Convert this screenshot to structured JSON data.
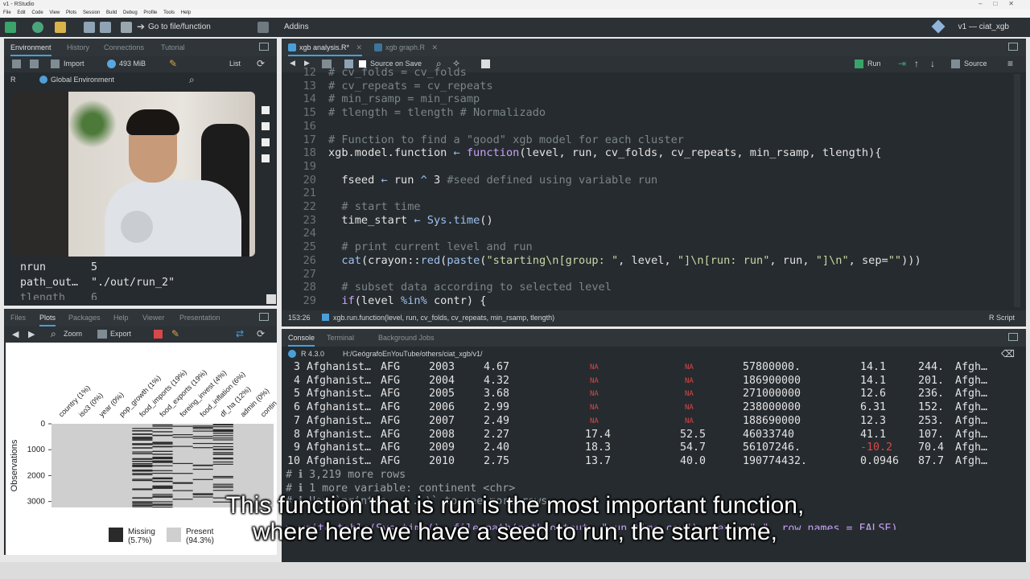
{
  "window": {
    "title": "v1 - RStudio"
  },
  "menu": [
    "File",
    "Edit",
    "Code",
    "View",
    "Plots",
    "Session",
    "Build",
    "Debug",
    "Profile",
    "Tools",
    "Help"
  ],
  "toolbar": {
    "goto": "Go to file/function",
    "addins": "Addins",
    "project": "v1 — ciat_xgb"
  },
  "env_pane": {
    "tabs": [
      "Environment",
      "History",
      "Connections",
      "Tutorial"
    ],
    "import_label": "Import",
    "memory": "493 MiB",
    "list_label": "List",
    "r_label": "R",
    "scope": "Global Environment",
    "vars": [
      {
        "name": "nrun",
        "value": "5"
      },
      {
        "name": "path_out…",
        "value": "\"./out/run_2\""
      },
      {
        "name": "tlength",
        "value": "6"
      }
    ]
  },
  "files_pane": {
    "tabs": [
      "Files",
      "Plots",
      "Packages",
      "Help",
      "Viewer",
      "Presentation"
    ],
    "zoom_label": "Zoom",
    "export_label": "Export"
  },
  "chart_data": {
    "type": "heatmap",
    "columns": [
      "country (1%)",
      "iso3 (0%)",
      "year (0%)",
      "pop_growth (1%)",
      "food_imports (19%)",
      "food_exports (19%)",
      "foreing_invest (4%)",
      "food_inflation (6%)",
      "df_ha (12%)",
      "admin (0%)",
      "contin"
    ],
    "ylabel": "Observations",
    "yticks": [
      "0",
      "1000",
      "2000",
      "3000"
    ],
    "ylim": [
      0,
      3229
    ],
    "legend": [
      {
        "label": "Missing",
        "pct": "(5.7%)",
        "color": "#2a2a2a"
      },
      {
        "label": "Present",
        "pct": "(94.3%)",
        "color": "#cfcfcf"
      }
    ]
  },
  "editor": {
    "tabs": [
      "xgb analysis.R*",
      "xgb graph.R"
    ],
    "source_on_save": "Source on Save",
    "run_label": "Run",
    "source_label": "Source",
    "status_pos": "153:26",
    "status_fn": "xgb.run.function(level, run, cv_folds, cv_repeats, min_rsamp, tlength)",
    "status_type": "R Script"
  },
  "console": {
    "tabs": [
      "Console",
      "Terminal",
      "Background Jobs"
    ],
    "r_version": "R 4.3.0",
    "path": "H:/GeógrafoEnYouTube/others/ciat_xgb/v1/",
    "rows": [
      {
        "i": "3",
        "c": "Afghanist…",
        "iso": "AFG",
        "y": "2003",
        "g": "4.67",
        "a": "NA",
        "b": "NA",
        "p": "57800000.",
        "d": "14.1",
        "e": "244.",
        "f": "Afgh…"
      },
      {
        "i": "4",
        "c": "Afghanist…",
        "iso": "AFG",
        "y": "2004",
        "g": "4.32",
        "a": "NA",
        "b": "NA",
        "p": "186900000",
        "d": "14.1",
        "e": "201.",
        "f": "Afgh…"
      },
      {
        "i": "5",
        "c": "Afghanist…",
        "iso": "AFG",
        "y": "2005",
        "g": "3.68",
        "a": "NA",
        "b": "NA",
        "p": "271000000",
        "d": "12.6",
        "e": "236.",
        "f": "Afgh…"
      },
      {
        "i": "6",
        "c": "Afghanist…",
        "iso": "AFG",
        "y": "2006",
        "g": "2.99",
        "a": "NA",
        "b": "NA",
        "p": "238000000",
        "d": "6.31",
        "e": "152.",
        "f": "Afgh…"
      },
      {
        "i": "7",
        "c": "Afghanist…",
        "iso": "AFG",
        "y": "2007",
        "g": "2.49",
        "a": "NA",
        "b": "NA",
        "p": "188690000",
        "d": "12.3",
        "e": "253.",
        "f": "Afgh…"
      },
      {
        "i": "8",
        "c": "Afghanist…",
        "iso": "AFG",
        "y": "2008",
        "g": "2.27",
        "a": "17.4",
        "b": "52.5",
        "p": "46033740",
        "d": "41.1",
        "e": "107.",
        "f": "Afgh…"
      },
      {
        "i": "9",
        "c": "Afghanist…",
        "iso": "AFG",
        "y": "2009",
        "g": "2.40",
        "a": "18.3",
        "b": "54.7",
        "p": "56107246.",
        "d": "-10.2",
        "e": "70.4",
        "f": "Afgh…"
      },
      {
        "i": "10",
        "c": "Afghanist…",
        "iso": "AFG",
        "y": "2010",
        "g": "2.75",
        "a": "13.7",
        "b": "40.0",
        "p": "190774432.",
        "d": "0.0946",
        "e": "87.7",
        "f": "Afgh…"
      }
    ],
    "more_rows": "# ℹ 3,219 more rows",
    "more_vars": "# ℹ 1 more variable: continent <chr>",
    "hint": "# ℹ Use `print(n = ...)` to see more rows",
    "cmd": "> write.table(Sys.time(), file.path(path_output, \"run_time.csv\"), sep = \",\", row.names = FALSE)"
  },
  "subtitle": {
    "line1": "This function that is run is the most important function,",
    "line2": "where here we have a seed to run, the start time,"
  }
}
